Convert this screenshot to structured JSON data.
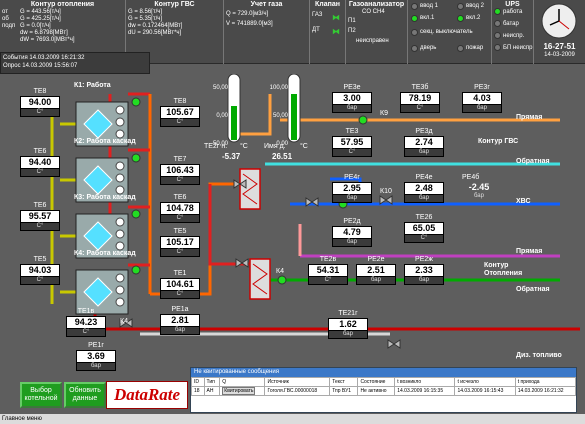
{
  "heating": {
    "title": "Контур отопления",
    "side": [
      "от",
      "об",
      "подп"
    ],
    "rows": [
      "G  = 443.56[т/ч]",
      "G  = 425.25[т/ч]",
      "G  = 0.0[т/ч]",
      "dw = 6.8798[МВт]",
      "dW = 7693.0[МВт*ч]"
    ]
  },
  "hotwater": {
    "title": "Контур ГВС",
    "rows": [
      "G = 8.56[т/ч]",
      "G = 5.35[т/ч]",
      "",
      "dw = 0.172464[МВт]",
      "dU = 290.56[МВт*ч]"
    ]
  },
  "gas": {
    "title": "Учет газа",
    "rows": [
      "Q   = 729.0[м3/ч]",
      "V   = 741889.0[м3]"
    ]
  },
  "valve": {
    "title": "Клапан",
    "items": [
      "ГАЗ",
      "ДТ"
    ]
  },
  "analyzer": {
    "title": "Газоанализатор",
    "sub": "CO   CH4",
    "items": [
      "П1",
      "П2",
      "неисправен"
    ]
  },
  "inputs": {
    "items": [
      "ввод 1",
      "вкл.1",
      "секц. выключатель",
      "дверь",
      "ввод 2",
      "вкл.2",
      "пожар"
    ]
  },
  "ups": {
    "title": "UPS",
    "items": [
      "работа",
      "батар",
      "неиспр.",
      "БП неиспр"
    ]
  },
  "clock": {
    "time": "16-27-51",
    "date": "14-03-2009"
  },
  "events": {
    "rows": [
      "События   14.03.2009 16:21:32",
      "Опрос       14.03.2009 15:56:07"
    ]
  },
  "boilers": [
    {
      "label": "К1: Работа"
    },
    {
      "label": "К2: Работа каскад"
    },
    {
      "label": "К3: Работа каскад"
    },
    {
      "label": "К4: Работа каскад"
    }
  ],
  "sensors": {
    "te8": {
      "name": "ТЕ8",
      "value": "94.00",
      "unit": "С°"
    },
    "te6": {
      "name": "ТЕ6",
      "value": "94.40",
      "unit": "С°"
    },
    "te66": {
      "name": "ТЕ6",
      "value": "95.57",
      "unit": "С°"
    },
    "te5": {
      "name": "ТЕ5",
      "value": "94.03",
      "unit": "С°"
    },
    "te8r": {
      "name": "ТЕ8",
      "value": "105.67",
      "unit": "С°"
    },
    "te7": {
      "name": "ТЕ7",
      "value": "106.43",
      "unit": "С°"
    },
    "te6r": {
      "name": "ТЕ6",
      "value": "104.78",
      "unit": "С°"
    },
    "te5r": {
      "name": "ТЕ5",
      "value": "105.17",
      "unit": "С°"
    },
    "te1": {
      "name": "ТЕ1",
      "value": "104.61",
      "unit": "С°"
    },
    "pe1a": {
      "name": "PE1а",
      "value": "2.81",
      "unit": "бар"
    },
    "te1b": {
      "name": "ТЕ1в",
      "value": "94.23",
      "unit": "С°"
    },
    "pe1g": {
      "name": "PE1г",
      "value": "3.69",
      "unit": "бар"
    },
    "pe3e": {
      "name": "PE3е",
      "value": "3.00",
      "unit": "бар"
    },
    "te3": {
      "name": "ТЕ3б",
      "value": "78.19",
      "unit": "С°"
    },
    "pe3g": {
      "name": "PE3г",
      "value": "4.03",
      "unit": "бар"
    },
    "te3z": {
      "name": "ТЕ3",
      "value": "57.95",
      "unit": "С°"
    },
    "pe3d": {
      "name": "PE3д",
      "value": "2.74",
      "unit": "бар"
    },
    "pe4g": {
      "name": "PE4г",
      "value": "2.95",
      "unit": "бар"
    },
    "pe4e": {
      "name": "PE4е",
      "value": "2.48",
      "unit": "бар"
    },
    "pe4b": {
      "name": "PE4б",
      "value": "-2.45",
      "unit": "бар"
    },
    "pe2d": {
      "name": "PE2д",
      "value": "4.79",
      "unit": "бар"
    },
    "te26": {
      "name": "ТЕ26",
      "value": "65.05",
      "unit": "С°"
    },
    "te2v": {
      "name": "ТЕ2в",
      "value": "54.31",
      "unit": "С°"
    },
    "pe2e": {
      "name": "PE2е",
      "value": "2.51",
      "unit": "бар"
    },
    "pe2zh": {
      "name": "PE2ж",
      "value": "2.33",
      "unit": "бар"
    },
    "te21": {
      "name": "ТЕ21г",
      "value": "1.62",
      "unit": "бар"
    }
  },
  "gauges": {
    "left": {
      "name": "ТЕ2г н.",
      "unit": "°C",
      "value": "-5.37",
      "ticks": [
        "50,00",
        "0,00",
        "-50,00"
      ]
    },
    "right": {
      "name": "Имя д.",
      "unit": "°C",
      "value": "26.51",
      "ticks": [
        "100,00",
        "50,00",
        "0,00"
      ]
    }
  },
  "lines": {
    "direct1": "Прямая",
    "hw": "Контур ГВС",
    "ret1": "Обратная",
    "xvs": "ХВС",
    "direct2": "Прямая",
    "heat": "Контур\nОтопления",
    "ret2": "Обратная",
    "fuel": "Диз. топливо"
  },
  "tags": {
    "k9": "К9",
    "k10": "К10",
    "k4": "К4",
    "k4b": "К4"
  },
  "buttons": {
    "select": "Выбор\nкотельной",
    "refresh": "Обновить\nданные"
  },
  "logo": "DataRate",
  "alarm": {
    "title": "Не квитированные сообщения",
    "cols": [
      "ID",
      "Тип",
      "Q",
      "Источник",
      "Текст",
      "Состояние",
      "t возникло",
      "t исчезло",
      "t прихода"
    ],
    "rows": [
      [
        "18",
        "АН",
        "Квитировать",
        "Гоголя.ГВС.00000018",
        "Тпр ВУ1",
        "Не активно",
        "14.03.2009 16:15:35",
        "14.03.2009 16:15:43",
        "14.03.2009 16:21:32"
      ]
    ]
  },
  "status": "Главное меню"
}
